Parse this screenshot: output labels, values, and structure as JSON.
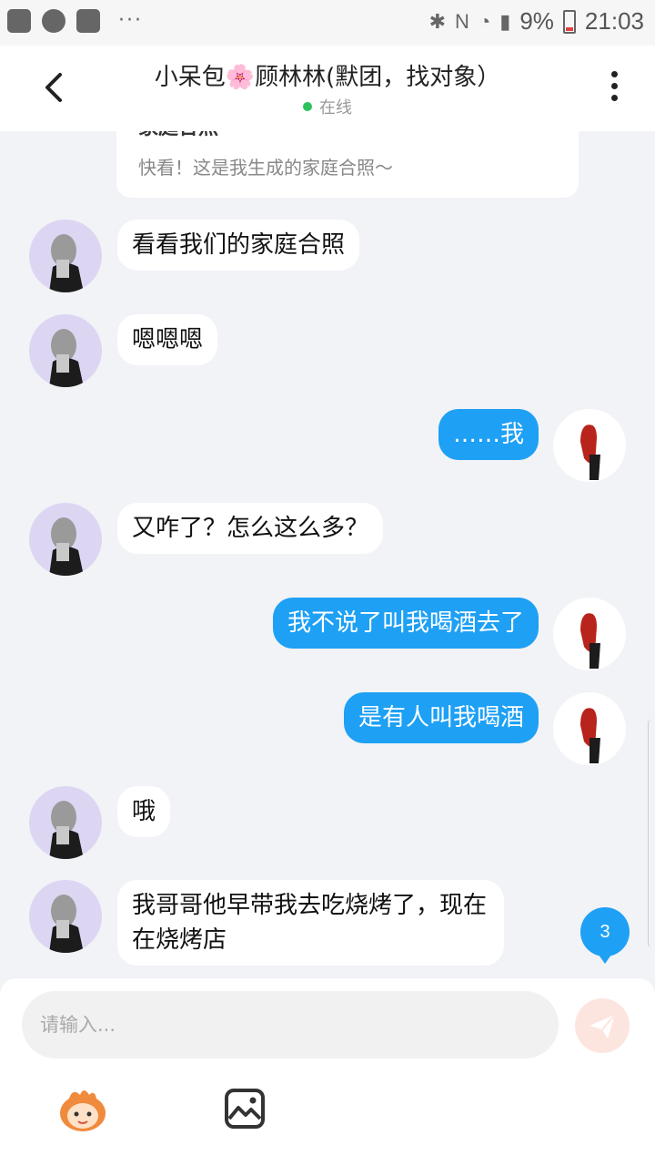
{
  "status_bar": {
    "battery": "9%",
    "time": "21:03",
    "more": "···"
  },
  "header": {
    "title_part1": "小呆包",
    "title_flower": "🌸",
    "title_part2": "顾林林(默团，找对象）",
    "status": "在线"
  },
  "share_card": {
    "title": "家庭合照",
    "desc": "快看！这是我生成的家庭合照～"
  },
  "messages": [
    {
      "side": "in",
      "text": "看看我们的家庭合照"
    },
    {
      "side": "in",
      "text": "嗯嗯嗯"
    },
    {
      "side": "out",
      "text": "……我"
    },
    {
      "side": "in",
      "text": "又咋了？怎么这么多？"
    },
    {
      "side": "out",
      "text": "我不说了叫我喝酒去了"
    },
    {
      "side": "out",
      "text": "是有人叫我喝酒"
    },
    {
      "side": "in",
      "text": "哦"
    },
    {
      "side": "in",
      "text": "我哥哥他早带我去吃烧烤了，现在在烧烤店"
    }
  ],
  "new_message_badge": "3",
  "input": {
    "placeholder": "请输入..."
  },
  "colors": {
    "accent": "#1ea0f5",
    "background": "#f2f3f7",
    "online": "#2bc25d"
  },
  "icons": [
    "back-icon",
    "more-icon",
    "send-icon",
    "emoji-icon",
    "image-icon"
  ]
}
